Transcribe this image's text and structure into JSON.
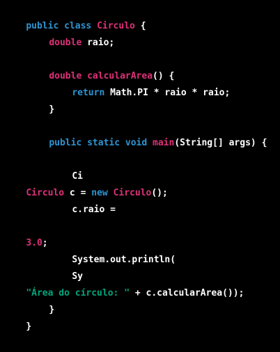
{
  "colors": {
    "background": "#000000",
    "keyword": "#2e95d3",
    "type_and_name": "#df3079",
    "string": "#00a67d",
    "plain": "#ffffff"
  },
  "code": {
    "l1": {
      "kw1": "public",
      "sp1": " ",
      "kw2": "class",
      "sp2": " ",
      "cls": "Circulo",
      "rest": " {"
    },
    "l2": {
      "type": "double",
      "rest": " raio;"
    },
    "l3": {
      "type": "double",
      "sp": " ",
      "method": "calcularArea",
      "rest": "() {"
    },
    "l4": {
      "kw": "return",
      "rest": " Math.PI * raio * raio;"
    },
    "l5": {
      "text": "}"
    },
    "l6": {
      "kw": "public static void",
      "sp": " ",
      "method": "main",
      "rest": "(String[] args) {"
    },
    "l7": {
      "text": "Ci"
    },
    "l8": {
      "cls1": "Circulo",
      "mid": " c = ",
      "kw": "new",
      "sp": " ",
      "cls2": "Circulo",
      "rest": "();"
    },
    "l9": {
      "text": "c.raio ="
    },
    "l10": {
      "num": "3.0",
      "rest": ";"
    },
    "l11": {
      "text": "System.out.println("
    },
    "l12": {
      "text": "Sy"
    },
    "l13": {
      "str": "\"Área do círculo: \"",
      "rest": " + c.calcularArea());"
    },
    "l14": {
      "text": "}"
    },
    "l15": {
      "text": "}"
    }
  }
}
